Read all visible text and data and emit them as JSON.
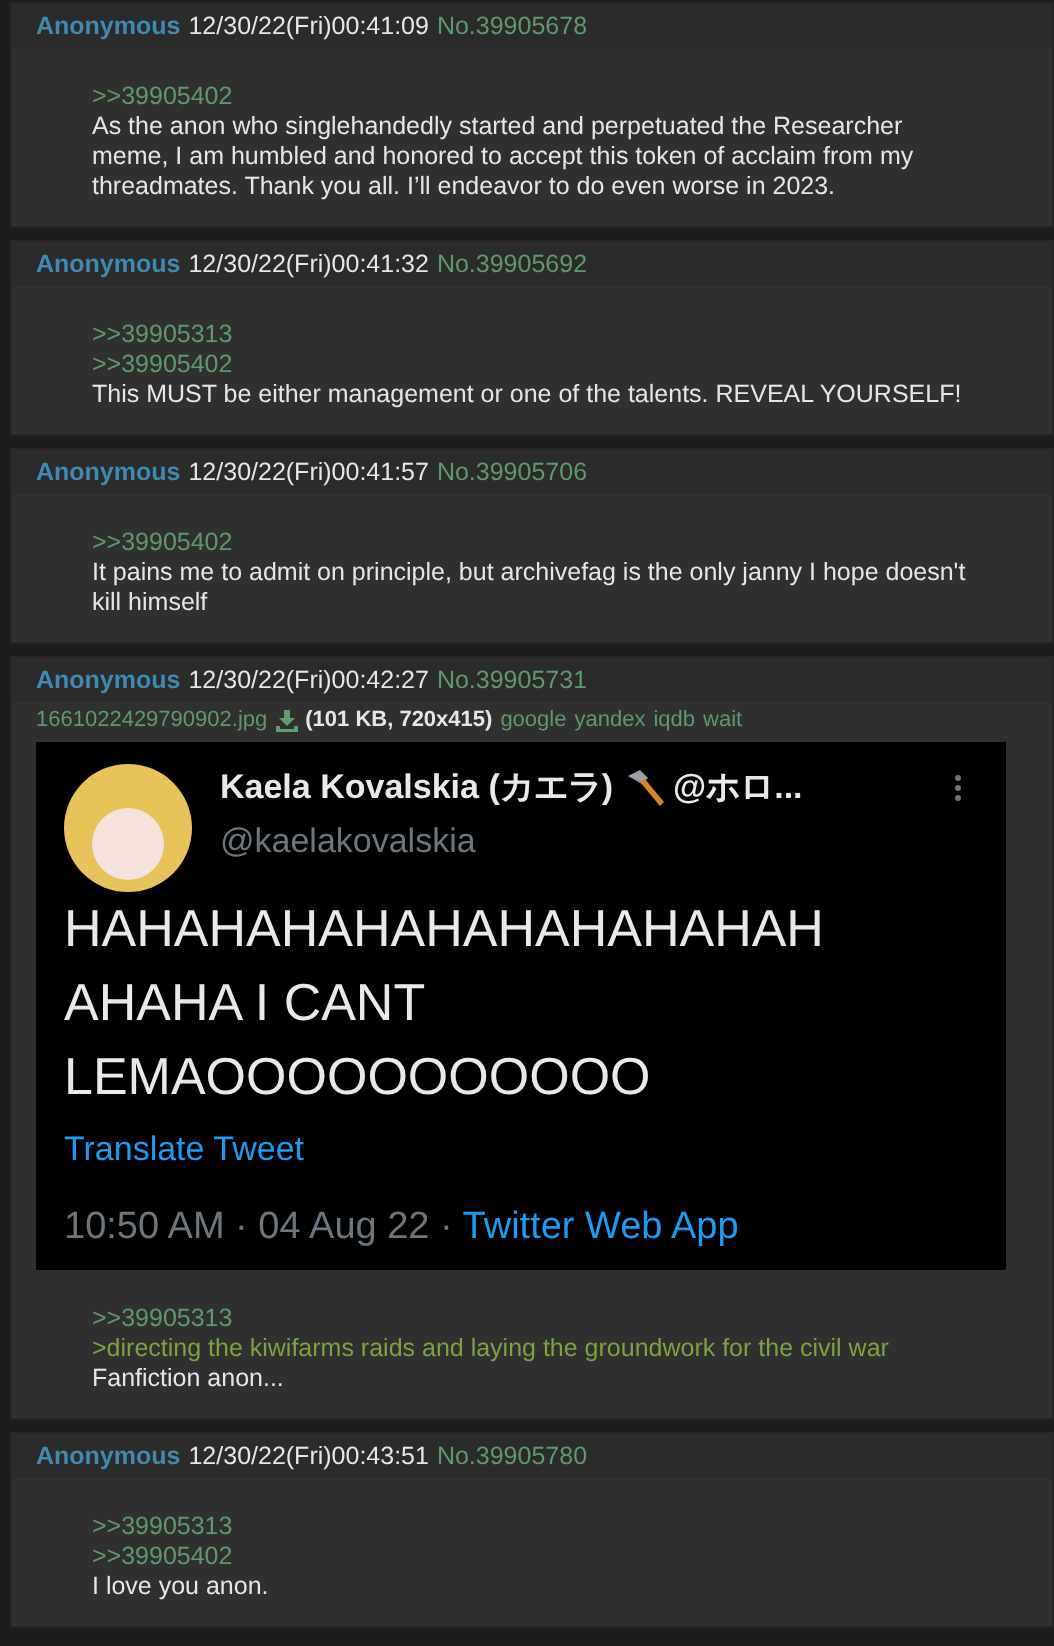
{
  "posts": [
    {
      "name": "Anonymous",
      "date": "12/30/22(Fri)00:41:09",
      "number": "No.39905678",
      "lines": [
        {
          "kind": "quotelink",
          "text": ">>39905402"
        },
        {
          "kind": "text",
          "text": "As the anon who singlehandedly started and perpetuated the Researcher meme, I am humbled and honored to accept this token of acclaim from my threadmates. Thank you all. I’ll endeavor to do even worse in 2023."
        }
      ]
    },
    {
      "name": "Anonymous",
      "date": "12/30/22(Fri)00:41:32",
      "number": "No.39905692",
      "lines": [
        {
          "kind": "quotelink",
          "text": ">>39905313"
        },
        {
          "kind": "quotelink",
          "text": ">>39905402"
        },
        {
          "kind": "text",
          "text": "This MUST be either management or one of the talents. REVEAL YOURSELF!"
        }
      ]
    },
    {
      "name": "Anonymous",
      "date": "12/30/22(Fri)00:41:57",
      "number": "No.39905706",
      "lines": [
        {
          "kind": "quotelink",
          "text": ">>39905402"
        },
        {
          "kind": "text",
          "text": "It pains me to admit on principle, but archivefag is the only janny I hope doesn't kill himself"
        }
      ]
    },
    {
      "name": "Anonymous",
      "date": "12/30/22(Fri)00:42:27",
      "number": "No.39905731",
      "file": {
        "filename": "1661022429790902.jpg",
        "info": "(101 KB, 720x415)",
        "search_links": [
          "google",
          "yandex",
          "iqdb",
          "wait"
        ],
        "tweet": {
          "display_name": "Kaela Kovalskia (カエラ)",
          "handle_cut": "@ホロ...",
          "handle": "@kaelakovalskia",
          "text_lines": [
            "HAHAHAHAHAHAHAHAHAHAH",
            "AHAHA I CANT",
            "LEMAOOOOOOOOOOO"
          ],
          "translate": "Translate Tweet",
          "meta": "10:50 AM · 04 Aug 22 · ",
          "source": "Twitter Web App"
        }
      },
      "lines": [
        {
          "kind": "quotelink",
          "text": ">>39905313"
        },
        {
          "kind": "greentext",
          "text": ">directing the kiwifarms raids and laying the groundwork for the civil war"
        },
        {
          "kind": "text",
          "text": "Fanfiction anon..."
        }
      ]
    },
    {
      "name": "Anonymous",
      "date": "12/30/22(Fri)00:43:51",
      "number": "No.39905780",
      "lines": [
        {
          "kind": "quotelink",
          "text": ">>39905313"
        },
        {
          "kind": "quotelink",
          "text": ">>39905402"
        },
        {
          "kind": "text",
          "text": "I love you anon."
        }
      ]
    }
  ]
}
